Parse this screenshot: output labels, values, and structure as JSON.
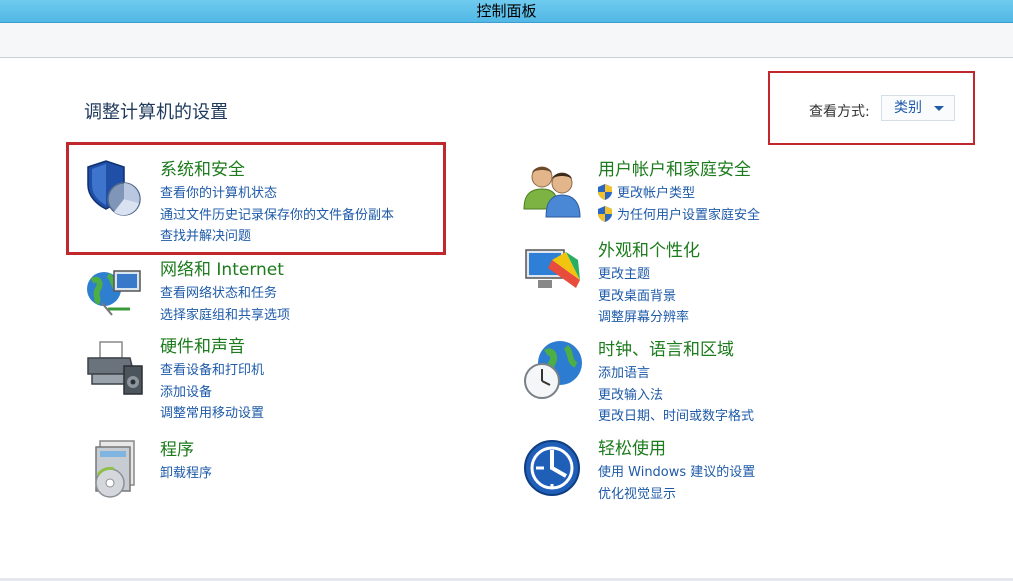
{
  "window": {
    "title": "控制面板"
  },
  "main": {
    "heading": "调整计算机的设置",
    "view_by": {
      "label": "查看方式:",
      "selected": "类别"
    }
  },
  "categories_left": [
    {
      "title": "系统和安全",
      "icon": "shield-icon",
      "links": [
        "查看你的计算机状态",
        "通过文件历史记录保存你的文件备份副本",
        "查找并解决问题"
      ]
    },
    {
      "title": "网络和 Internet",
      "icon": "network-icon",
      "links": [
        "查看网络状态和任务",
        "选择家庭组和共享选项"
      ]
    },
    {
      "title": "硬件和声音",
      "icon": "printer-icon",
      "links": [
        "查看设备和打印机",
        "添加设备",
        "调整常用移动设置"
      ]
    },
    {
      "title": "程序",
      "icon": "programs-icon",
      "links": [
        "卸载程序"
      ]
    }
  ],
  "categories_right": [
    {
      "title": "用户帐户和家庭安全",
      "icon": "users-icon",
      "links": [
        "更改帐户类型",
        "为任何用户设置家庭安全"
      ]
    },
    {
      "title": "外观和个性化",
      "icon": "appearance-icon",
      "links": [
        "更改主题",
        "更改桌面背景",
        "调整屏幕分辨率"
      ]
    },
    {
      "title": "时钟、语言和区域",
      "icon": "clock-globe-icon",
      "links": [
        "添加语言",
        "更改输入法",
        "更改日期、时间或数字格式"
      ]
    },
    {
      "title": "轻松使用",
      "icon": "ease-of-access-icon",
      "links": [
        "使用 Windows 建议的设置",
        "优化视觉显示"
      ]
    }
  ],
  "colors": {
    "accent_red": "#c0282e",
    "category_green": "#1c7b1c",
    "link_blue": "#1e5aa8",
    "title_bar": "#5ec0ea"
  }
}
